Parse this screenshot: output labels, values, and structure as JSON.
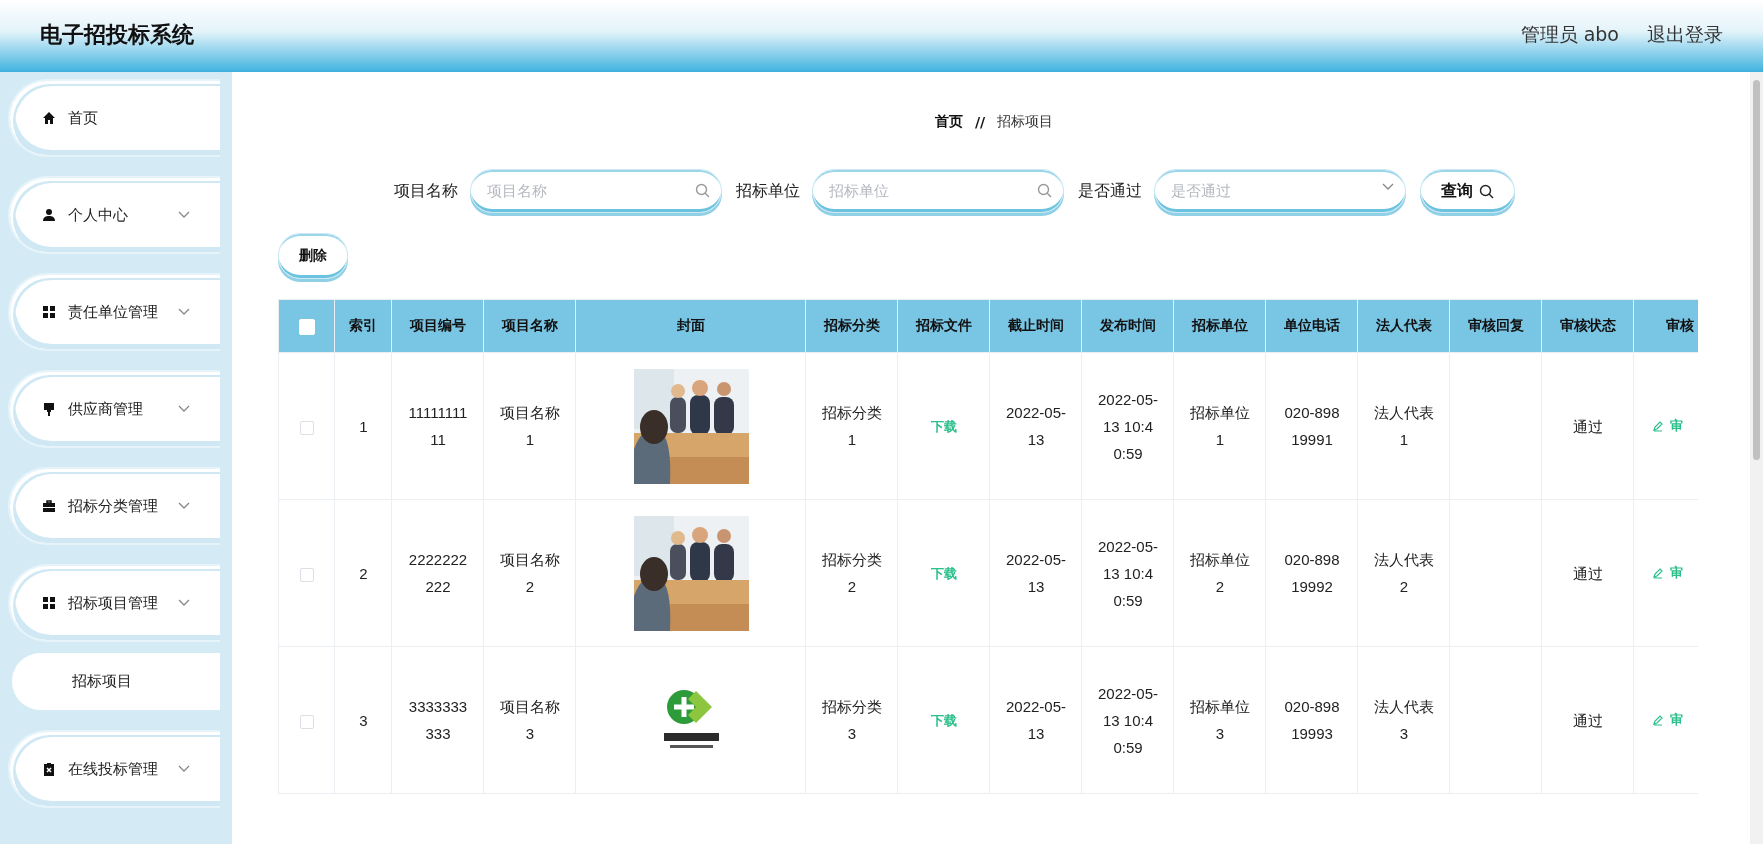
{
  "header": {
    "title": "电子招投标系统",
    "user": "管理员 abo",
    "logout": "退出登录"
  },
  "sidebar": {
    "items": [
      {
        "label": "首页",
        "expandable": false
      },
      {
        "label": "个人中心",
        "expandable": true
      },
      {
        "label": "责任单位管理",
        "expandable": true
      },
      {
        "label": "供应商管理",
        "expandable": true
      },
      {
        "label": "招标分类管理",
        "expandable": true
      },
      {
        "label": "招标项目管理",
        "expandable": true,
        "children": [
          {
            "label": "招标项目"
          }
        ]
      },
      {
        "label": "在线投标管理",
        "expandable": true
      }
    ]
  },
  "breadcrumb": {
    "home": "首页",
    "separator": "//",
    "current": "招标项目"
  },
  "search": {
    "fields": [
      {
        "label": "项目名称",
        "placeholder": "项目名称",
        "kind": "text"
      },
      {
        "label": "招标单位",
        "placeholder": "招标单位",
        "kind": "text"
      },
      {
        "label": "是否通过",
        "placeholder": "是否通过",
        "kind": "select"
      }
    ],
    "button": "查询"
  },
  "delete_button": "删除",
  "table": {
    "select_all": false,
    "columns": [
      "索引",
      "项目编号",
      "项目名称",
      "封面",
      "招标分类",
      "招标文件",
      "截止时间",
      "发布时间",
      "招标单位",
      "单位电话",
      "法人代表",
      "审核回复",
      "审核状态",
      "审核"
    ],
    "rows": [
      {
        "checked": false,
        "index": "1",
        "code": "1111111111",
        "name": "项目名称1",
        "category": "招标分类1",
        "file": "下载",
        "deadline": "2022-05-13",
        "published": "2022-05-13 10:40:59",
        "unit": "招标单位1",
        "phone": "020-89819991",
        "representative": "法人代表1",
        "status": "通过",
        "action": "审"
      },
      {
        "checked": false,
        "index": "2",
        "code": "2222222222",
        "name": "项目名称2",
        "category": "招标分类2",
        "file": "下载",
        "deadline": "2022-05-13",
        "published": "2022-05-13 10:40:59",
        "unit": "招标单位2",
        "phone": "020-89819992",
        "representative": "法人代表2",
        "status": "通过",
        "action": "审"
      },
      {
        "checked": false,
        "index": "3",
        "code": "3333333333",
        "name": "项目名称3",
        "category": "招标分类3",
        "file": "下载",
        "deadline": "2022-05-13",
        "published": "2022-05-13 10:40:59",
        "unit": "招标单位3",
        "phone": "020-89819993",
        "representative": "法人代表3",
        "status": "通过",
        "action": "审"
      }
    ]
  }
}
